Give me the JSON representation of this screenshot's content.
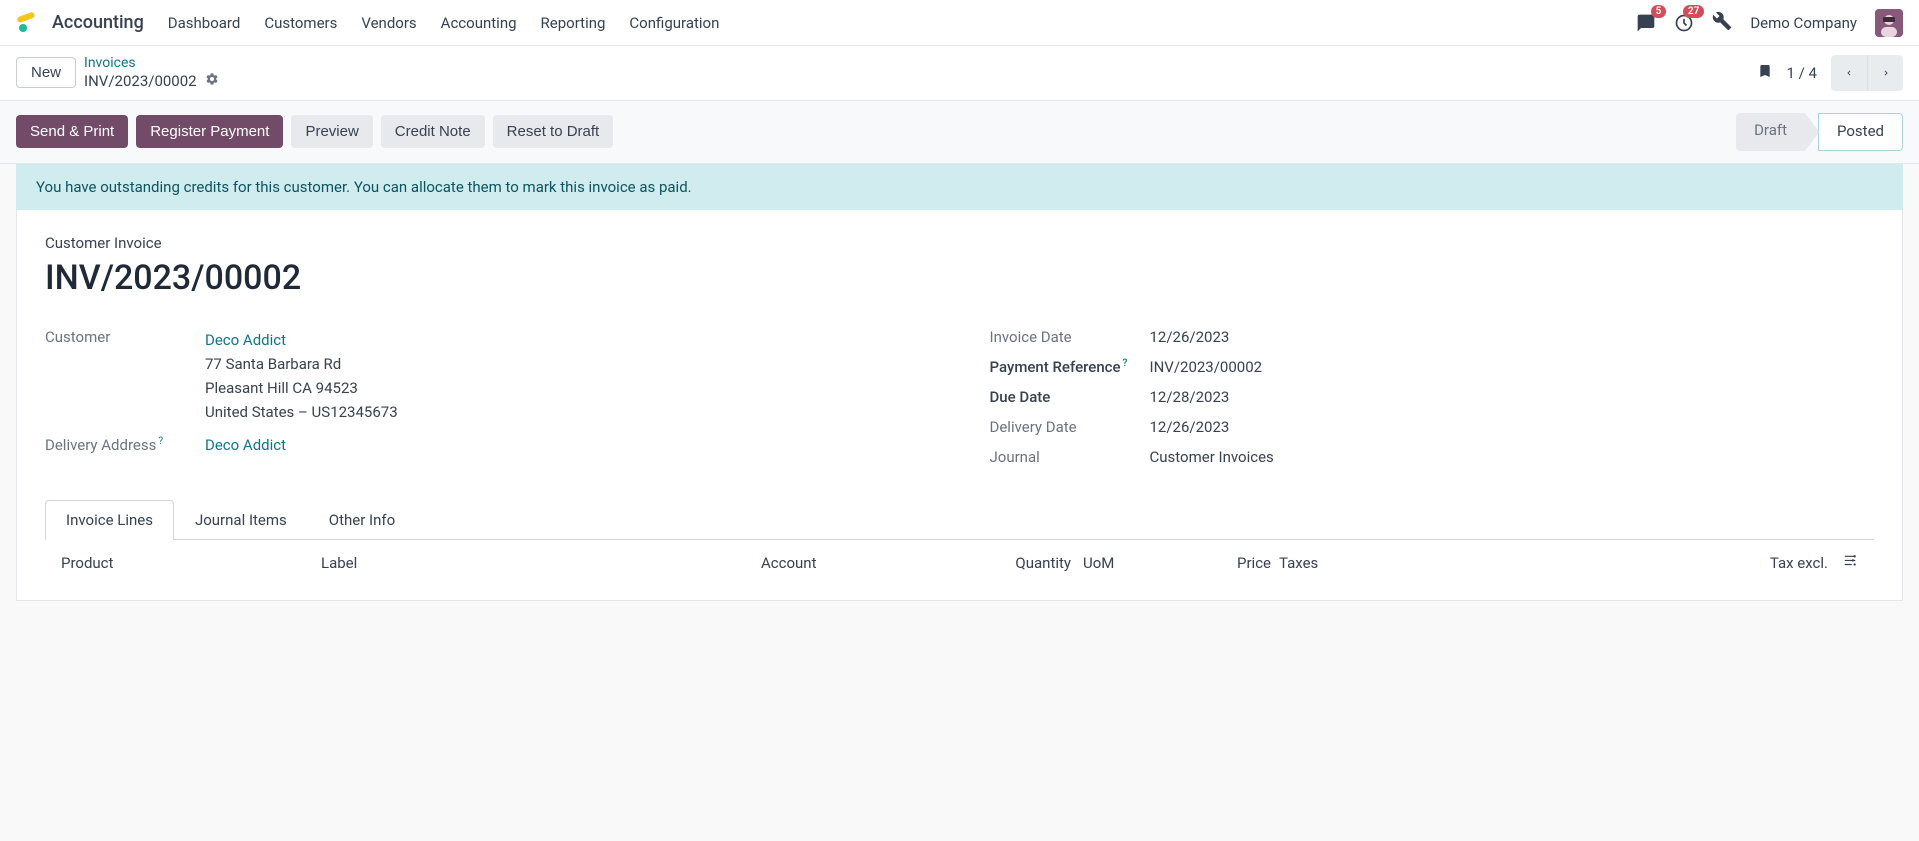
{
  "nav": {
    "app": "Accounting",
    "items": [
      "Dashboard",
      "Customers",
      "Vendors",
      "Accounting",
      "Reporting",
      "Configuration"
    ],
    "msg_badge": "5",
    "act_badge": "27",
    "company": "Demo Company"
  },
  "crumb": {
    "new": "New",
    "parent": "Invoices",
    "current": "INV/2023/00002",
    "pager": "1 / 4"
  },
  "actions": {
    "send_print": "Send & Print",
    "register_payment": "Register Payment",
    "preview": "Preview",
    "credit_note": "Credit Note",
    "reset_draft": "Reset to Draft",
    "status_draft": "Draft",
    "status_posted": "Posted"
  },
  "alert": "You have outstanding credits for this customer. You can allocate them to mark this invoice as paid.",
  "doc": {
    "type": "Customer Invoice",
    "name": "INV/2023/00002"
  },
  "left": {
    "customer_label": "Customer",
    "customer_name": "Deco Addict",
    "addr1": "77 Santa Barbara Rd",
    "addr2": "Pleasant Hill CA 94523",
    "addr3": "United States – US12345673",
    "delivery_label": "Delivery Address",
    "delivery_value": "Deco Addict"
  },
  "right": {
    "invoice_date_label": "Invoice Date",
    "invoice_date": "12/26/2023",
    "payment_ref_label": "Payment Reference",
    "payment_ref": "INV/2023/00002",
    "due_date_label": "Due Date",
    "due_date": "12/28/2023",
    "delivery_date_label": "Delivery Date",
    "delivery_date": "12/26/2023",
    "journal_label": "Journal",
    "journal": "Customer Invoices"
  },
  "tabs": {
    "lines": "Invoice Lines",
    "journal": "Journal Items",
    "other": "Other Info"
  },
  "cols": {
    "product": "Product",
    "label": "Label",
    "account": "Account",
    "qty": "Quantity",
    "uom": "UoM",
    "price": "Price",
    "taxes": "Taxes",
    "taxexcl": "Tax excl."
  }
}
